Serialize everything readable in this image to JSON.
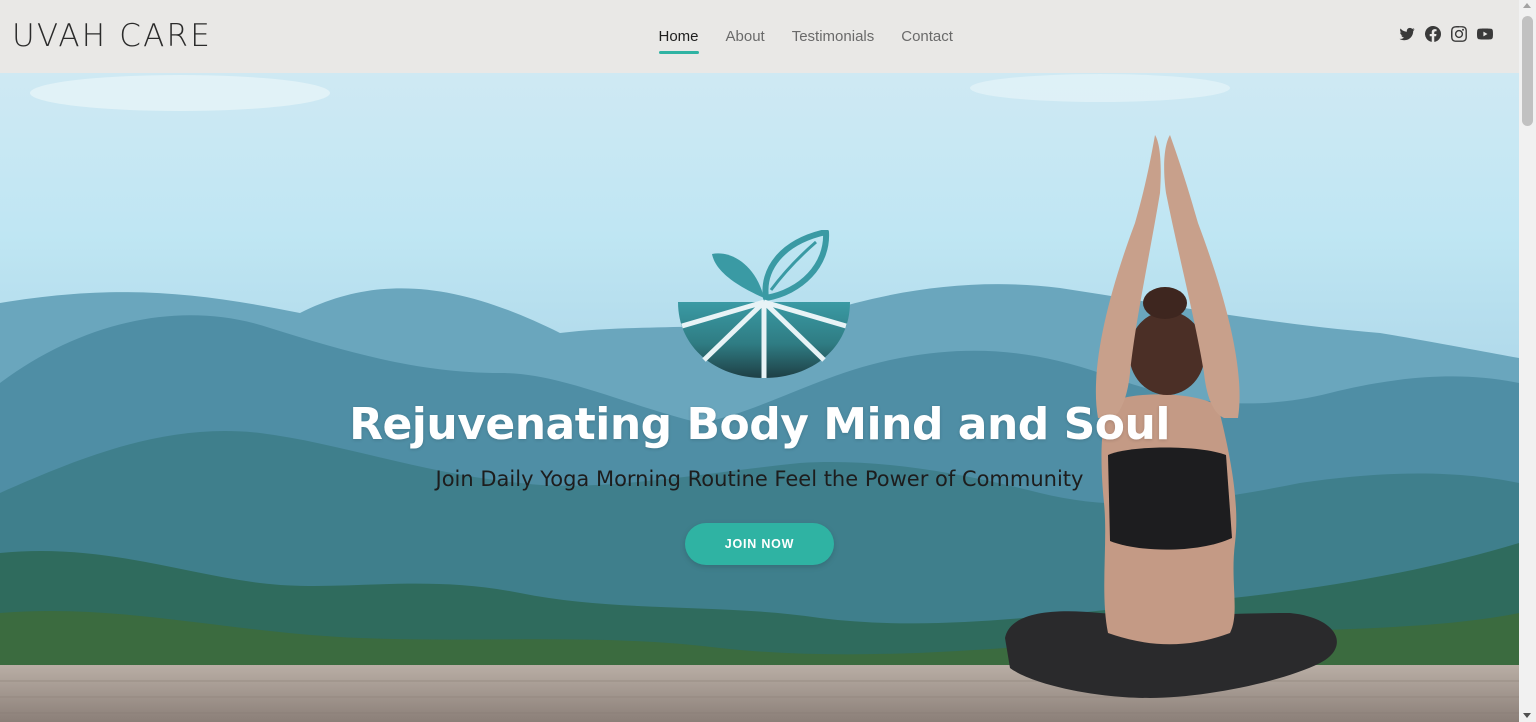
{
  "brand": {
    "name": "UVAH CARE"
  },
  "nav": {
    "items": [
      {
        "label": "Home",
        "active": true
      },
      {
        "label": "About",
        "active": false
      },
      {
        "label": "Testimonials",
        "active": false
      },
      {
        "label": "Contact",
        "active": false
      }
    ]
  },
  "social": {
    "icons": [
      "twitter-icon",
      "facebook-icon",
      "instagram-icon",
      "youtube-icon"
    ]
  },
  "hero": {
    "headline": "Rejuvenating Body Mind and Soul",
    "subheadline": "Join Daily Yoga Morning Routine Feel the Power of Community",
    "cta_label": "JOIN NOW"
  },
  "colors": {
    "accent": "#2fb3a3",
    "header_bg": "#e9e8e6",
    "logo_teal": "#3a9aa4",
    "logo_dark": "#1e3f45"
  }
}
